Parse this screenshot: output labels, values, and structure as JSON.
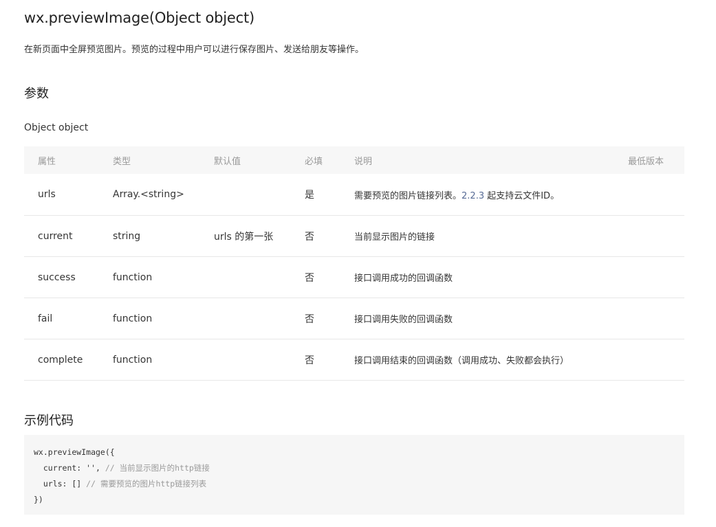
{
  "doc": {
    "title": "wx.previewImage(Object object)",
    "description": "在新页面中全屏预览图片。预览的过程中用户可以进行保存图片、发送给朋友等操作。",
    "params_heading": "参数",
    "object_label": "Object object",
    "example_heading": "示例代码"
  },
  "table": {
    "headers": {
      "attr": "属性",
      "type": "类型",
      "default": "默认值",
      "required": "必填",
      "desc": "说明",
      "min_version": "最低版本"
    },
    "rows": [
      {
        "attr": "urls",
        "type": "Array.<string>",
        "default": "",
        "required": "是",
        "desc_pre": "需要预览的图片链接列表。",
        "desc_link": "2.2.3",
        "desc_post": " 起支持云文件ID。",
        "min_version": ""
      },
      {
        "attr": "current",
        "type": "string",
        "default": "urls 的第一张",
        "required": "否",
        "desc": "当前显示图片的链接",
        "min_version": ""
      },
      {
        "attr": "success",
        "type": "function",
        "default": "",
        "required": "否",
        "desc": "接口调用成功的回调函数",
        "min_version": ""
      },
      {
        "attr": "fail",
        "type": "function",
        "default": "",
        "required": "否",
        "desc": "接口调用失败的回调函数",
        "min_version": ""
      },
      {
        "attr": "complete",
        "type": "function",
        "default": "",
        "required": "否",
        "desc": "接口调用结束的回调函数（调用成功、失败都会执行）",
        "min_version": ""
      }
    ]
  },
  "code": {
    "line1": "wx.previewImage({",
    "line2_code": "  current: '', ",
    "line2_comment": "// 当前显示图片的http链接",
    "line3_code": "  urls: [] ",
    "line3_comment": "// 需要预览的图片http链接列表",
    "line4": "})"
  },
  "colors": {
    "link": "#576b95",
    "header_bg": "#f7f7f7",
    "code_bg": "#f6f6f6",
    "border": "#e7e7e7"
  }
}
